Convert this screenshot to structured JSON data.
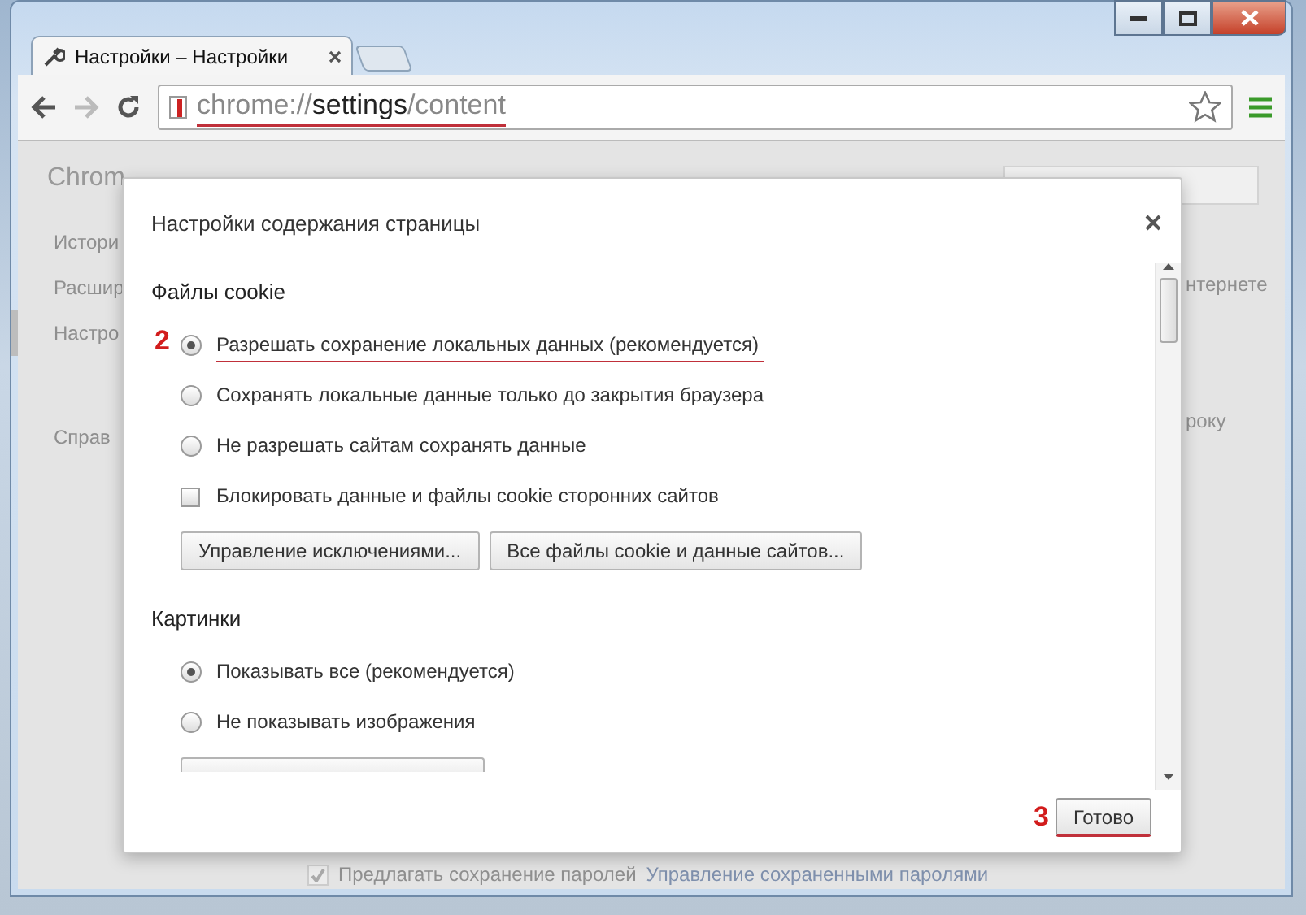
{
  "tab": {
    "title": "Настройки – Настройки"
  },
  "address": {
    "scheme": "chrome://",
    "host": "settings",
    "path": "/content",
    "underlined": true
  },
  "background": {
    "logo_fragment": "Chrom",
    "sidebar": [
      {
        "label": "Истори",
        "selected": false
      },
      {
        "label": "Расшир",
        "selected": false
      },
      {
        "label": "Настро",
        "selected": true
      },
      {
        "label": "Справ",
        "selected": false
      }
    ],
    "right_fragments": [
      "нтернете",
      "року"
    ],
    "passwords": {
      "label": "Предлагать сохранение паролей",
      "checked": true,
      "link": "Управление сохраненными паролями"
    }
  },
  "dialog": {
    "title": "Настройки содержания страницы",
    "sections": [
      {
        "title": "Файлы cookie",
        "options": [
          {
            "kind": "radio",
            "label": "Разрешать сохранение локальных данных (рекомендуется)",
            "selected": true,
            "annotation": "2",
            "underlined": true
          },
          {
            "kind": "radio",
            "label": "Сохранять локальные данные только до закрытия браузера",
            "selected": false
          },
          {
            "kind": "radio",
            "label": "Не разрешать сайтам сохранять данные",
            "selected": false
          },
          {
            "kind": "checkbox",
            "label": "Блокировать данные и файлы cookie сторонних сайтов",
            "checked": false
          }
        ],
        "buttons": [
          "Управление исключениями...",
          "Все файлы cookie и данные сайтов..."
        ]
      },
      {
        "title": "Картинки",
        "options": [
          {
            "kind": "radio",
            "label": "Показывать все (рекомендуется)",
            "selected": true
          },
          {
            "kind": "radio",
            "label": "Не показывать изображения",
            "selected": false
          }
        ],
        "cut_off_button": true
      }
    ],
    "done": {
      "label": "Готово",
      "annotation": "3",
      "underlined": true
    }
  }
}
